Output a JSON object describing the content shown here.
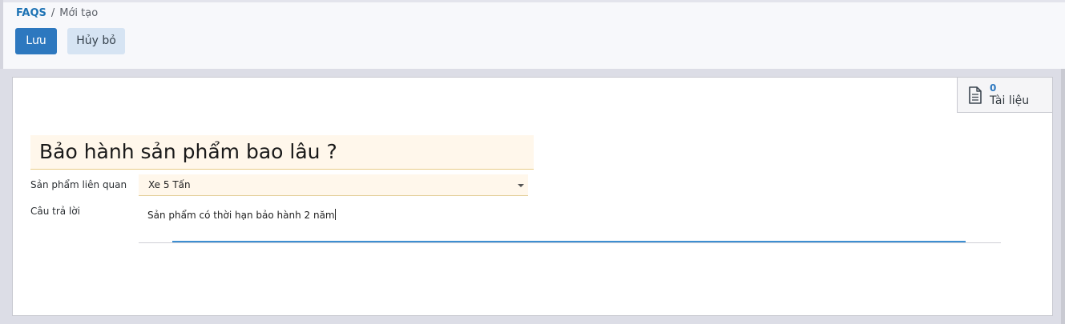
{
  "breadcrumb": {
    "parent": "FAQS",
    "separator": "/",
    "current": "Mới tạo"
  },
  "toolbar": {
    "save_label": "Lưu",
    "cancel_label": "Hủy bỏ"
  },
  "smart_button": {
    "count": "0",
    "label": "Tài liệu",
    "icon": "document-icon"
  },
  "form": {
    "title": "Bảo hành sản phẩm bao lâu ?",
    "fields": {
      "product_label": "Sản phẩm liên quan",
      "product_value": "Xe 5 Tấn",
      "answer_label": "Câu trả lời",
      "answer_value": "Sản phẩm có thời hạn bảo hành 2 năm"
    }
  },
  "colors": {
    "primary": "#2d78bf",
    "required_field_bg": "#fff7eb",
    "focus_line": "#3d8fd2"
  }
}
